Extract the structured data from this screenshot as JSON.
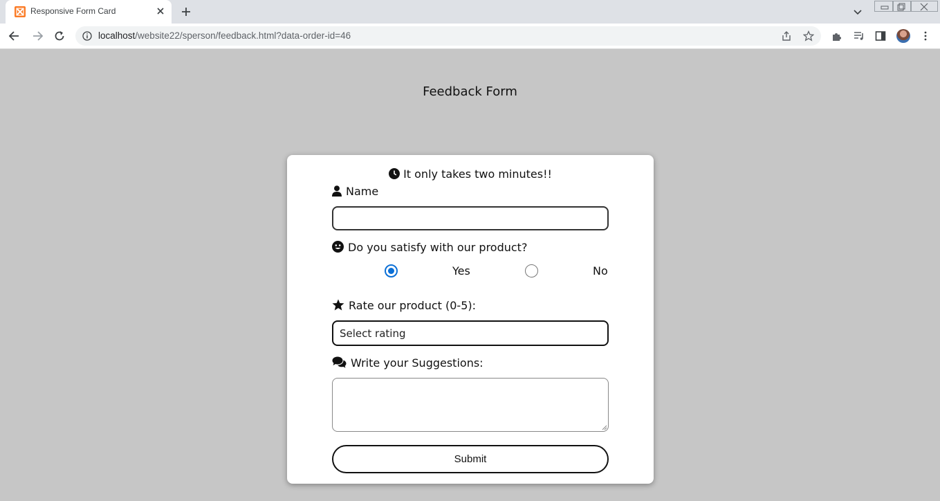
{
  "browser": {
    "tab_title": "Responsive Form Card",
    "url_host": "localhost",
    "url_path": "/website22/sperson/feedback.html?data-order-id=46"
  },
  "page": {
    "title": "Feedback Form"
  },
  "form": {
    "subtitle": "It only takes two minutes!!",
    "name_label": "Name",
    "name_value": "",
    "satisfy_label": "Do you satisfy with our product?",
    "options": [
      {
        "label": "Yes",
        "checked": true
      },
      {
        "label": "No",
        "checked": false
      }
    ],
    "rate_label": "Rate our product (0-5):",
    "rating_selected": "Select rating",
    "suggestions_label": "Write your Suggestions:",
    "suggestions_value": "",
    "submit_label": "Submit"
  },
  "colors": {
    "page_background": "#c6c6c6",
    "card_background": "#ffffff",
    "radio_accent": "#0b6fd6"
  }
}
